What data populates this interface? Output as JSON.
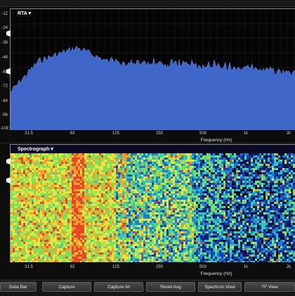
{
  "rta": {
    "label": "RTA▼",
    "y_ticks": [
      "-12",
      "-24",
      "-36",
      "-48",
      "-60",
      "-72",
      "-84",
      "-96",
      "-108"
    ],
    "x_ticks": [
      "31.5",
      "63",
      "125",
      "250",
      "500",
      "1k",
      "2k"
    ],
    "x_axis_title": "Frequency (Hz)",
    "fill_color": "#3f67c9"
  },
  "spectrograph": {
    "label": "Spectrograph▼",
    "x_ticks": [
      "31.5",
      "63",
      "125",
      "250",
      "500",
      "1k",
      "2k"
    ],
    "x_axis_title": "Frequency (Hz)"
  },
  "toolbar": {
    "buttons": [
      "Data Bar",
      "Capture",
      "Capture All",
      "Reset Avg",
      "Spectrum View",
      "TF View"
    ]
  }
}
